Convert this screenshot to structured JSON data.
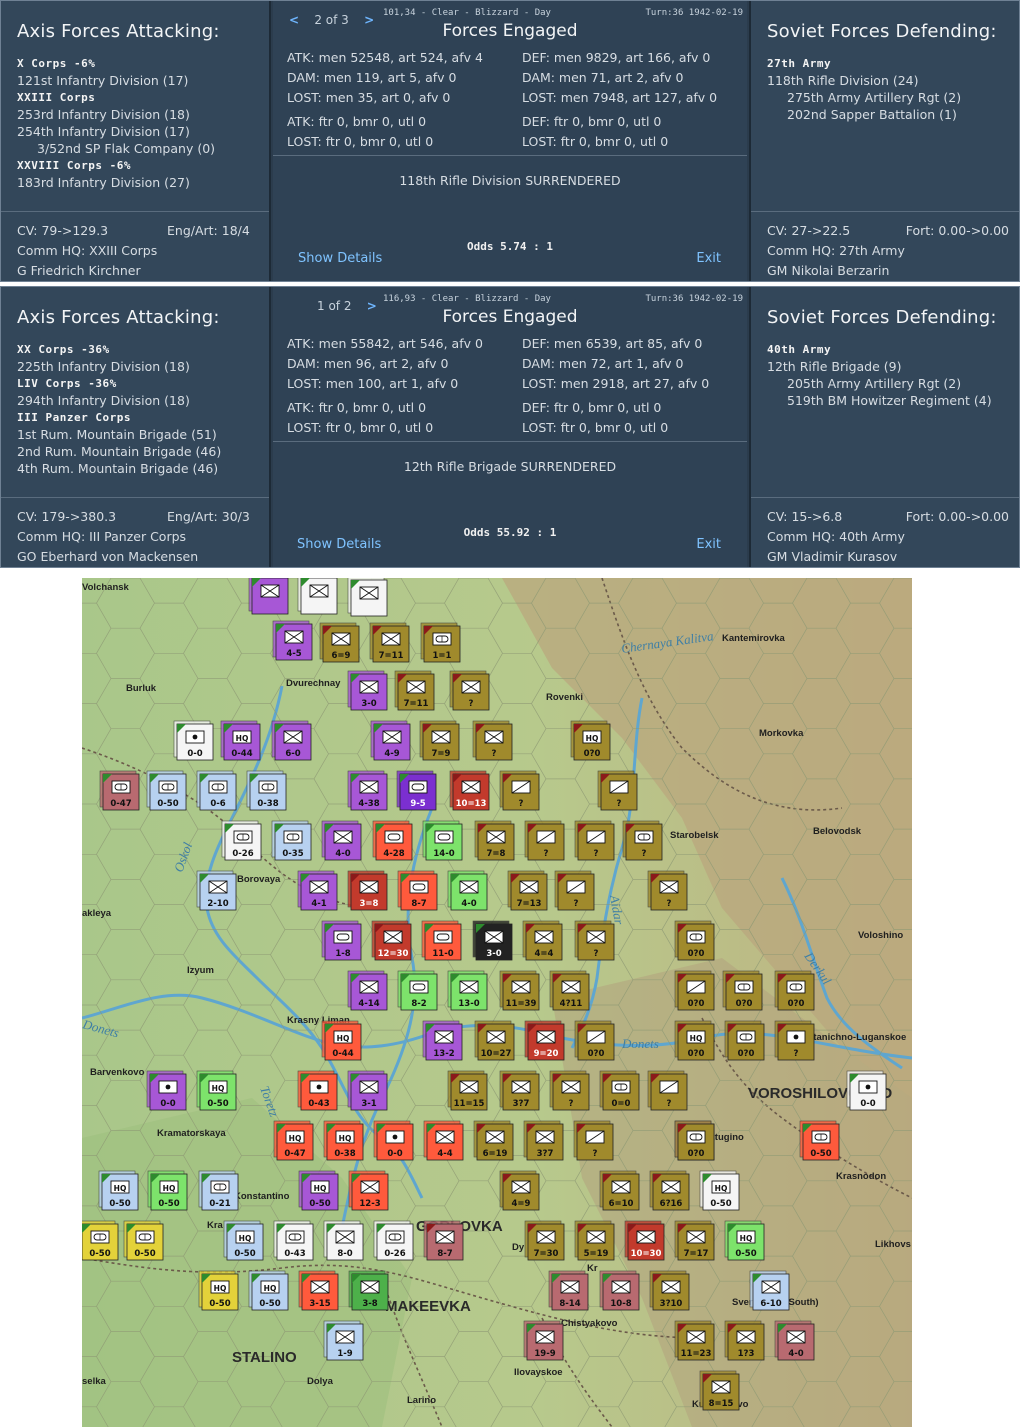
{
  "reports": [
    {
      "left_heading": "Axis Forces Attacking:",
      "left_oob": [
        {
          "t": "X Corps  -6%",
          "k": "corps"
        },
        {
          "t": "121st Infantry Division (17)",
          "k": "unit"
        },
        {
          "t": "XXIII Corps",
          "k": "corps"
        },
        {
          "t": "253rd Infantry Division (18)",
          "k": "unit"
        },
        {
          "t": "254th Infantry Division (17)",
          "k": "unit"
        },
        {
          "t": "3/52nd SP Flak Company (0)",
          "k": "sub"
        },
        {
          "t": "XXVIII Corps  -6%",
          "k": "corps"
        },
        {
          "t": "183rd Infantry Division (27)",
          "k": "unit"
        }
      ],
      "left_cv": "CV: 79->129.3",
      "left_engart": "Eng/Art: 18/4",
      "left_hq": "Comm HQ: XXIII Corps",
      "left_cmdr": "G Friedrich Kirchner",
      "nav_prev": "<",
      "nav_page": "2 of 3",
      "nav_next": ">",
      "location": "101,34 - Clear - Blizzard - Day",
      "turn": "Turn:36  1942-02-19",
      "mid_title": "Forces Engaged",
      "atk_lines": [
        "ATK: men 52548, art 524, afv 4",
        "DAM: men 119, art 5, afv 0",
        "LOST: men 35, art 0, afv 0"
      ],
      "atk_air": [
        "ATK: ftr 0, bmr 0, utl 0",
        "LOST: ftr 0, bmr 0, utl 0"
      ],
      "def_lines": [
        "DEF: men 9829, art 166, afv 0",
        "DAM: men 71, art 2, afv 0",
        "LOST: men 7948, art 127, afv 0"
      ],
      "def_air": [
        "DEF: ftr 0, bmr 0, utl 0",
        "LOST: ftr 0, bmr 0, utl 0"
      ],
      "result": "118th Rifle Division SURRENDERED",
      "odds": "Odds 5.74 : 1",
      "show_details": "Show Details",
      "exit": "Exit",
      "right_heading": "Soviet Forces Defending:",
      "right_oob": [
        {
          "t": "27th Army",
          "k": "corps"
        },
        {
          "t": "118th Rifle Division (24)",
          "k": "unit"
        },
        {
          "t": "275th Army Artillery Rgt (2)",
          "k": "sub"
        },
        {
          "t": "202nd Sapper Battalion (1)",
          "k": "sub"
        }
      ],
      "right_cv": "CV: 27->22.5",
      "right_fort": "Fort: 0.00->0.00",
      "right_hq": "Comm HQ: 27th Army",
      "right_cmdr": "GM Nikolai Berzarin"
    },
    {
      "left_heading": "Axis Forces Attacking:",
      "left_oob": [
        {
          "t": "XX Corps  -36%",
          "k": "corps"
        },
        {
          "t": "225th Infantry Division (18)",
          "k": "unit"
        },
        {
          "t": "LIV Corps  -36%",
          "k": "corps"
        },
        {
          "t": "294th Infantry Division (18)",
          "k": "unit"
        },
        {
          "t": "III Panzer Corps",
          "k": "corps"
        },
        {
          "t": "1st Rum. Mountain Brigade (51)",
          "k": "unit"
        },
        {
          "t": "2nd Rum. Mountain Brigade (46)",
          "k": "unit"
        },
        {
          "t": "4th Rum. Mountain Brigade (46)",
          "k": "unit"
        }
      ],
      "left_cv": "CV: 179->380.3",
      "left_engart": "Eng/Art: 30/3",
      "left_hq": "Comm HQ: III Panzer Corps",
      "left_cmdr": "GO Eberhard von Mackensen",
      "nav_prev": "",
      "nav_page": "1 of 2",
      "nav_next": ">",
      "location": "116,93 - Clear - Blizzard - Day",
      "turn": "Turn:36  1942-02-19",
      "mid_title": "Forces Engaged",
      "atk_lines": [
        "ATK: men 55842, art 546, afv 0",
        "DAM: men 96, art 2, afv 0",
        "LOST: men 100, art 1, afv 0"
      ],
      "atk_air": [
        "ATK: ftr 0, bmr 0, utl 0",
        "LOST: ftr 0, bmr 0, utl 0"
      ],
      "def_lines": [
        "DEF: men 6539, art 85, afv 0",
        "DAM: men 72, art 1, afv 0",
        "LOST: men 2918, art 27, afv 0"
      ],
      "def_air": [
        "DEF: ftr 0, bmr 0, utl 0",
        "LOST: ftr 0, bmr 0, utl 0"
      ],
      "result": "12th Rifle Brigade SURRENDERED",
      "odds": "Odds 55.92 : 1",
      "show_details": "Show Details",
      "exit": "Exit",
      "right_heading": "Soviet Forces Defending:",
      "right_oob": [
        {
          "t": "40th Army",
          "k": "corps"
        },
        {
          "t": "12th Rifle Brigade (9)",
          "k": "unit"
        },
        {
          "t": "205th Army Artillery Rgt (2)",
          "k": "sub"
        },
        {
          "t": "519th BM Howitzer Regiment (4)",
          "k": "sub"
        }
      ],
      "right_cv": "CV: 15->6.8",
      "right_fort": "Fort: 0.00->0.00",
      "right_hq": "Comm HQ: 40th Army",
      "right_cmdr": "GM Vladimir Kurasov"
    }
  ],
  "map": {
    "cities": [
      "Volchansk",
      "Burluk",
      "Dvurechnay",
      "Rovenki",
      "Kantemirovka",
      "Morkovka",
      "Starobelsk",
      "Belovodsk",
      "Borovaya",
      "akleya",
      "Izyum",
      "Voloshino",
      "Krasny Liman",
      "Barvenkovo",
      "Stanichno-Luganskoe",
      "Kramatorskaya",
      "utugino",
      "Konstantino",
      "Krasnodon",
      "Kra",
      "Likhovs",
      "Sverdlovsk (South)",
      "Chistyakovo",
      "Dolya",
      "Ilovayskoe",
      "Larino",
      "Kuybyshevo",
      "selka",
      "Dy",
      "Kr"
    ],
    "big_cities": [
      "VOROSHILOVGRAD",
      "MAKEEVKA",
      "STALINO",
      "GORLOVKA"
    ],
    "rivers": [
      "Chernaya Kalitva",
      "Oskol",
      "Donets",
      "Donets",
      "Derkul",
      "Aidar",
      "Toretz"
    ],
    "counters": [
      {
        "s": "ax",
        "c": "#a757d6",
        "t": "inf",
        "l": ""
      },
      {
        "s": "ax",
        "c": "#f5f5f5",
        "t": "inf",
        "l": ""
      },
      {
        "s": "ax",
        "c": "#f5f5f5",
        "t": "inf",
        "l": ""
      },
      {
        "s": "ax",
        "c": "#a757d6",
        "t": "inf",
        "l": "4-5"
      },
      {
        "s": "sv",
        "c": "#a08a2c",
        "t": "inf",
        "l": "6=9"
      },
      {
        "s": "sv",
        "c": "#a08a2c",
        "t": "inf",
        "l": "7=11"
      },
      {
        "s": "sv",
        "c": "#a08a2c",
        "t": "mot",
        "l": "1=1"
      },
      {
        "s": "ax",
        "c": "#a757d6",
        "t": "inf",
        "l": "3-0"
      },
      {
        "s": "sv",
        "c": "#a08a2c",
        "t": "inf",
        "l": "7=11"
      },
      {
        "s": "sv",
        "c": "#a08a2c",
        "t": "inf",
        "l": "?"
      },
      {
        "s": "ax",
        "c": "#f5f5f5",
        "t": "art",
        "l": "0-0"
      },
      {
        "s": "ax",
        "c": "#a757d6",
        "t": "hq",
        "l": "0-44"
      },
      {
        "s": "ax",
        "c": "#a757d6",
        "t": "inf",
        "l": "6-0"
      },
      {
        "s": "ax",
        "c": "#a757d6",
        "t": "inf",
        "l": "4-9"
      },
      {
        "s": "sv",
        "c": "#a08a2c",
        "t": "inf",
        "l": "7=9"
      },
      {
        "s": "sv",
        "c": "#a08a2c",
        "t": "inf",
        "l": "?"
      },
      {
        "s": "sv",
        "c": "#a08a2c",
        "t": "hq",
        "l": "0?0"
      },
      {
        "s": "ax",
        "c": "#b86a70",
        "t": "mot",
        "l": "0-47"
      },
      {
        "s": "ax",
        "c": "#b7d1f0",
        "t": "mot",
        "l": "0-50"
      },
      {
        "s": "ax",
        "c": "#b7d1f0",
        "t": "mot",
        "l": "0-6"
      },
      {
        "s": "ax",
        "c": "#b7d1f0",
        "t": "mot",
        "l": "0-38"
      },
      {
        "s": "ax",
        "c": "#a757d6",
        "t": "inf",
        "l": "4-38"
      },
      {
        "s": "ax",
        "c": "#7b2fd0",
        "t": "arm",
        "l": "9-5"
      },
      {
        "s": "sv",
        "c": "#c23a2c",
        "t": "inf",
        "l": "10=13"
      },
      {
        "s": "sv",
        "c": "#a08a2c",
        "t": "cav",
        "l": "?"
      },
      {
        "s": "sv",
        "c": "#a08a2c",
        "t": "cav",
        "l": "?"
      },
      {
        "s": "ax",
        "c": "#f5f5f5",
        "t": "mot",
        "l": "0-26"
      },
      {
        "s": "ax",
        "c": "#b7d1f0",
        "t": "mot",
        "l": "0-35"
      },
      {
        "s": "ax",
        "c": "#a757d6",
        "t": "inf",
        "l": "4-0"
      },
      {
        "s": "ax",
        "c": "#ff5a3c",
        "t": "arm",
        "l": "4-28"
      },
      {
        "s": "ax",
        "c": "#7de36b",
        "t": "arm",
        "l": "14-0"
      },
      {
        "s": "sv",
        "c": "#a08a2c",
        "t": "inf",
        "l": "7=8"
      },
      {
        "s": "sv",
        "c": "#a08a2c",
        "t": "cav",
        "l": "?"
      },
      {
        "s": "sv",
        "c": "#a08a2c",
        "t": "cav",
        "l": "?"
      },
      {
        "s": "sv",
        "c": "#a08a2c",
        "t": "mot",
        "l": "?"
      },
      {
        "s": "ax",
        "c": "#b7d1f0",
        "t": "inf",
        "l": "2-10"
      },
      {
        "s": "ax",
        "c": "#a757d6",
        "t": "inf",
        "l": "4-1"
      },
      {
        "s": "sv",
        "c": "#c23a2c",
        "t": "inf",
        "l": "3=8"
      },
      {
        "s": "ax",
        "c": "#ff5a3c",
        "t": "arm",
        "l": "8-7"
      },
      {
        "s": "ax",
        "c": "#7de36b",
        "t": "inf",
        "l": "4-0"
      },
      {
        "s": "sv",
        "c": "#a08a2c",
        "t": "inf",
        "l": "7=13"
      },
      {
        "s": "sv",
        "c": "#a08a2c",
        "t": "cav",
        "l": "?"
      },
      {
        "s": "sv",
        "c": "#a08a2c",
        "t": "inf",
        "l": "?"
      },
      {
        "s": "ax",
        "c": "#a757d6",
        "t": "arm",
        "l": "1-8"
      },
      {
        "s": "sv",
        "c": "#c23a2c",
        "t": "inf",
        "l": "12=30"
      },
      {
        "s": "ax",
        "c": "#ff5a3c",
        "t": "arm",
        "l": "11-0"
      },
      {
        "s": "ax",
        "c": "#222222",
        "t": "inf",
        "l": "3-0"
      },
      {
        "s": "sv",
        "c": "#a08a2c",
        "t": "inf",
        "l": "4=4"
      },
      {
        "s": "sv",
        "c": "#a08a2c",
        "t": "inf",
        "l": "?"
      },
      {
        "s": "sv",
        "c": "#a08a2c",
        "t": "mot",
        "l": "0?0"
      },
      {
        "s": "ax",
        "c": "#a757d6",
        "t": "inf",
        "l": "4-14"
      },
      {
        "s": "ax",
        "c": "#7de36b",
        "t": "arm",
        "l": "8-2"
      },
      {
        "s": "ax",
        "c": "#7de36b",
        "t": "inf",
        "l": "13-0"
      },
      {
        "s": "sv",
        "c": "#a08a2c",
        "t": "inf",
        "l": "11=39"
      },
      {
        "s": "sv",
        "c": "#a08a2c",
        "t": "inf",
        "l": "4?11"
      },
      {
        "s": "sv",
        "c": "#a08a2c",
        "t": "cav",
        "l": "0?0"
      },
      {
        "s": "sv",
        "c": "#a08a2c",
        "t": "mot",
        "l": "0?0"
      },
      {
        "s": "sv",
        "c": "#a08a2c",
        "t": "mot",
        "l": "0?0"
      },
      {
        "s": "ax",
        "c": "#ff5a3c",
        "t": "hq",
        "l": "0-44"
      },
      {
        "s": "ax",
        "c": "#a757d6",
        "t": "inf",
        "l": "13-2"
      },
      {
        "s": "sv",
        "c": "#a08a2c",
        "t": "inf",
        "l": "10=27"
      },
      {
        "s": "sv",
        "c": "#c23a2c",
        "t": "inf",
        "l": "9=20"
      },
      {
        "s": "sv",
        "c": "#a08a2c",
        "t": "cav",
        "l": "0?0"
      },
      {
        "s": "sv",
        "c": "#a08a2c",
        "t": "hq",
        "l": "0?0"
      },
      {
        "s": "sv",
        "c": "#a08a2c",
        "t": "mot",
        "l": "0?0"
      },
      {
        "s": "sv",
        "c": "#a08a2c",
        "t": "art",
        "l": "?"
      },
      {
        "s": "ax",
        "c": "#f5f5f5",
        "t": "art",
        "l": "0-0"
      },
      {
        "s": "ax",
        "c": "#a757d6",
        "t": "art",
        "l": "0-0"
      },
      {
        "s": "ax",
        "c": "#7de36b",
        "t": "hq",
        "l": "0-50"
      },
      {
        "s": "ax",
        "c": "#ff5a3c",
        "t": "art",
        "l": "0-43"
      },
      {
        "s": "ax",
        "c": "#a757d6",
        "t": "inf",
        "l": "3-1"
      },
      {
        "s": "sv",
        "c": "#a08a2c",
        "t": "inf",
        "l": "11=15"
      },
      {
        "s": "sv",
        "c": "#a08a2c",
        "t": "inf",
        "l": "3?7"
      },
      {
        "s": "sv",
        "c": "#a08a2c",
        "t": "inf",
        "l": "?"
      },
      {
        "s": "sv",
        "c": "#a08a2c",
        "t": "mot",
        "l": "0=0"
      },
      {
        "s": "sv",
        "c": "#a08a2c",
        "t": "cav",
        "l": "?"
      },
      {
        "s": "ax",
        "c": "#a757d6",
        "t": "hq",
        "l": "0-50"
      },
      {
        "s": "ax",
        "c": "#ff5a3c",
        "t": "hq",
        "l": "0-47"
      },
      {
        "s": "ax",
        "c": "#ff5a3c",
        "t": "hq",
        "l": "0-38"
      },
      {
        "s": "ax",
        "c": "#ff5a3c",
        "t": "art",
        "l": "0-0"
      },
      {
        "s": "ax",
        "c": "#ff5a3c",
        "t": "inf",
        "l": "4-4"
      },
      {
        "s": "sv",
        "c": "#a08a2c",
        "t": "inf",
        "l": "6=19"
      },
      {
        "s": "sv",
        "c": "#a08a2c",
        "t": "inf",
        "l": "3?7"
      },
      {
        "s": "sv",
        "c": "#a08a2c",
        "t": "cav",
        "l": "?"
      },
      {
        "s": "sv",
        "c": "#a08a2c",
        "t": "mot",
        "l": "0?0"
      },
      {
        "s": "ax",
        "c": "#ff5a3c",
        "t": "mot",
        "l": "0-50"
      },
      {
        "s": "ax",
        "c": "#b7d1f0",
        "t": "hq",
        "l": "0-50"
      },
      {
        "s": "ax",
        "c": "#7de36b",
        "t": "hq",
        "l": "0-50"
      },
      {
        "s": "ax",
        "c": "#b7d1f0",
        "t": "mot",
        "l": "0-21"
      },
      {
        "s": "ax",
        "c": "#a757d6",
        "t": "hq",
        "l": "0-50"
      },
      {
        "s": "ax",
        "c": "#ff5a3c",
        "t": "inf",
        "l": "12-3"
      },
      {
        "s": "sv",
        "c": "#a08a2c",
        "t": "inf",
        "l": "4=9"
      },
      {
        "s": "sv",
        "c": "#a08a2c",
        "t": "inf",
        "l": "6=10"
      },
      {
        "s": "sv",
        "c": "#a08a2c",
        "t": "inf",
        "l": "6?16"
      },
      {
        "s": "ax",
        "c": "#f5f5f5",
        "t": "hq",
        "l": "0-50"
      },
      {
        "s": "ax",
        "c": "#e3d23a",
        "t": "mot",
        "l": "0-50"
      },
      {
        "s": "ax",
        "c": "#e3d23a",
        "t": "mot",
        "l": "0-50"
      },
      {
        "s": "ax",
        "c": "#b7d1f0",
        "t": "hq",
        "l": "0-50"
      },
      {
        "s": "ax",
        "c": "#f5f5f5",
        "t": "mot",
        "l": "0-43"
      },
      {
        "s": "ax",
        "c": "#f5f5f5",
        "t": "inf",
        "l": "8-0"
      },
      {
        "s": "ax",
        "c": "#f5f5f5",
        "t": "mot",
        "l": "0-26"
      },
      {
        "s": "sv",
        "c": "#b86a70",
        "t": "inf",
        "l": "8-7"
      },
      {
        "s": "sv",
        "c": "#a08a2c",
        "t": "inf",
        "l": "7=30"
      },
      {
        "s": "sv",
        "c": "#a08a2c",
        "t": "inf",
        "l": "5=19"
      },
      {
        "s": "sv",
        "c": "#c23a2c",
        "t": "inf",
        "l": "10=30"
      },
      {
        "s": "sv",
        "c": "#a08a2c",
        "t": "inf",
        "l": "7=17"
      },
      {
        "s": "ax",
        "c": "#7de36b",
        "t": "hq",
        "l": "0-50"
      },
      {
        "s": "ax",
        "c": "#e3d23a",
        "t": "hq",
        "l": "0-50"
      },
      {
        "s": "ax",
        "c": "#b7d1f0",
        "t": "hq",
        "l": "0-50"
      },
      {
        "s": "ax",
        "c": "#ff5a3c",
        "t": "inf",
        "l": "3-15"
      },
      {
        "s": "ax",
        "c": "#4db04a",
        "t": "inf",
        "l": "3-8"
      },
      {
        "s": "ax",
        "c": "#b86a70",
        "t": "inf",
        "l": "8-14"
      },
      {
        "s": "ax",
        "c": "#b86a70",
        "t": "inf",
        "l": "10-8"
      },
      {
        "s": "sv",
        "c": "#a08a2c",
        "t": "inf",
        "l": "3?10"
      },
      {
        "s": "ax",
        "c": "#b7d1f0",
        "t": "inf",
        "l": "6-10"
      },
      {
        "s": "ax",
        "c": "#b7d1f0",
        "t": "inf",
        "l": "1-9"
      },
      {
        "s": "ax",
        "c": "#b86a70",
        "t": "inf",
        "l": "19-9"
      },
      {
        "s": "sv",
        "c": "#a08a2c",
        "t": "inf",
        "l": "11=23"
      },
      {
        "s": "sv",
        "c": "#a08a2c",
        "t": "inf",
        "l": "1?3"
      },
      {
        "s": "ax",
        "c": "#b86a70",
        "t": "inf",
        "l": "4-0"
      },
      {
        "s": "sv",
        "c": "#a08a2c",
        "t": "inf",
        "l": "8=15"
      }
    ]
  }
}
